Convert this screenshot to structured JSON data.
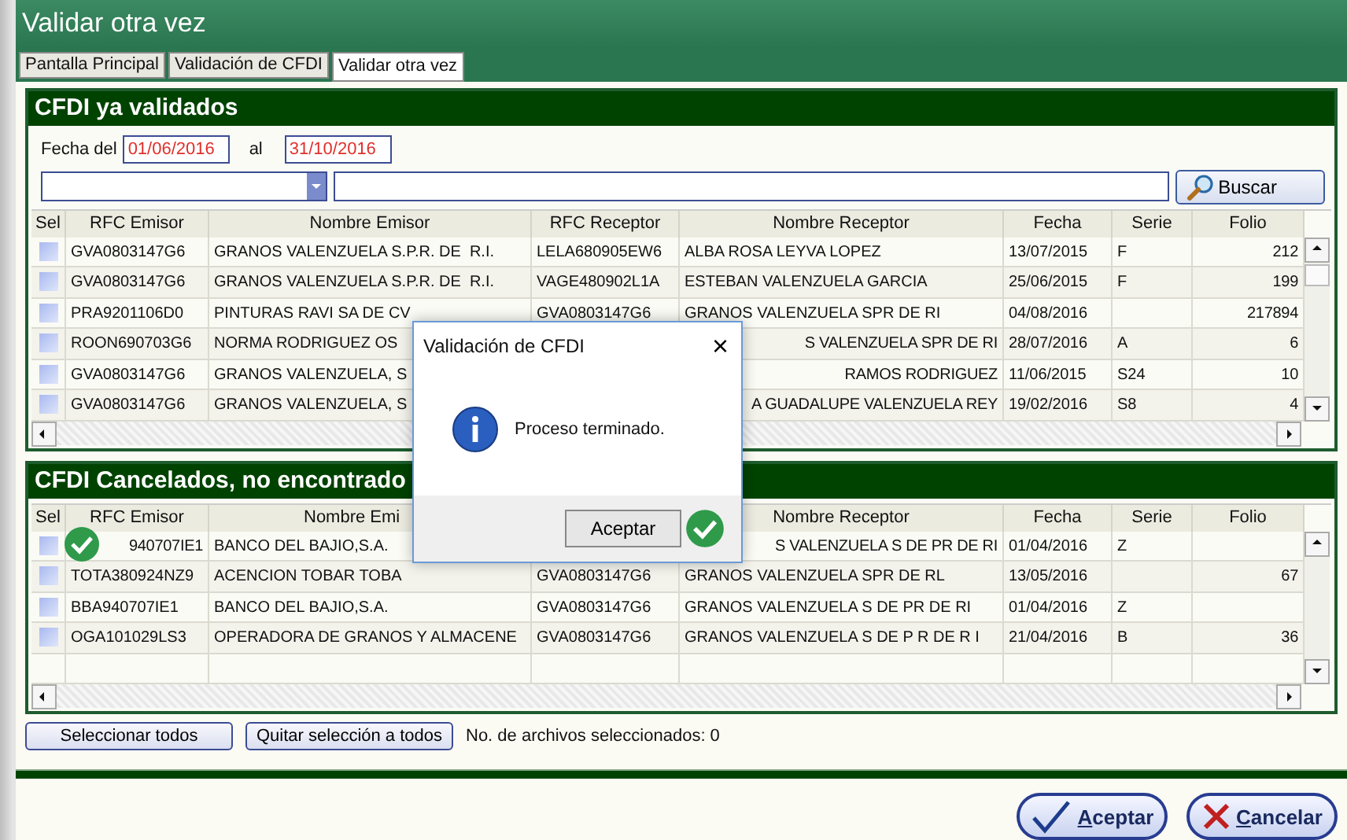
{
  "window": {
    "title": "Validar otra vez"
  },
  "tabs": [
    {
      "label": "Pantalla Principal",
      "selected": false
    },
    {
      "label": "Validación de CFDI",
      "selected": false
    },
    {
      "label": "Validar otra vez",
      "selected": true
    }
  ],
  "validated": {
    "title": "CFDI ya validados",
    "date_from_label": "Fecha del",
    "date_from": "01/06/2016",
    "date_to_label": "al",
    "date_to": "31/10/2016",
    "search_button": "Buscar",
    "selection_column": "Sel",
    "columns": [
      "RFC Emisor",
      "Nombre Emisor",
      "RFC Receptor",
      "Nombre Receptor",
      "Fecha",
      "Serie",
      "Folio"
    ],
    "rows": [
      {
        "checked": false,
        "cells": [
          "GVA0803147G6",
          "GRANOS VALENZUELA S.P.R. DE  R.I.",
          "LELA680905EW6",
          "ALBA ROSA LEYVA LOPEZ",
          "13/07/2015",
          "F",
          "212"
        ]
      },
      {
        "checked": false,
        "cells": [
          "GVA0803147G6",
          "GRANOS VALENZUELA S.P.R. DE  R.I.",
          "VAGE480902L1A",
          "ESTEBAN VALENZUELA GARCIA",
          "25/06/2015",
          "F",
          "199"
        ]
      },
      {
        "checked": false,
        "cells": [
          "PRA9201106D0",
          "PINTURAS RAVI SA DE CV",
          "GVA0803147G6",
          "GRANOS VALENZUELA SPR DE RI",
          "04/08/2016",
          null,
          "217894"
        ]
      },
      {
        "checked": false,
        "cells": [
          "ROON690703G6",
          "NORMA RODRIGUEZ OS",
          null,
          {
            "text": "S VALENZUELA SPR DE RI",
            "clipped": true
          },
          "28/07/2016",
          "A",
          "6"
        ]
      },
      {
        "checked": false,
        "cells": [
          "GVA0803147G6",
          "GRANOS VALENZUELA, S",
          null,
          {
            "text": "RAMOS RODRIGUEZ",
            "clipped": true
          },
          "11/06/2015",
          "S24",
          "10"
        ]
      },
      {
        "checked": false,
        "cells": [
          "GVA0803147G6",
          "GRANOS VALENZUELA, S",
          null,
          {
            "text": "A GUADALUPE VALENZUELA REY",
            "clipped": true
          },
          "19/02/2016",
          "S8",
          "4"
        ]
      }
    ]
  },
  "cancelled": {
    "title": "CFDI Cancelados, no encontrado",
    "selection_column": "Sel",
    "columns": [
      "RFC Emisor",
      {
        "text": "Nombre Emi",
        "clipped": true
      },
      null,
      "Nombre Receptor",
      "Fecha",
      "Serie",
      "Folio"
    ],
    "rows": [
      {
        "checked": false,
        "cells": [
          {
            "text": "940707IE1",
            "clipped": true
          },
          "BANCO DEL BAJIO,S.A.",
          null,
          {
            "text": "S VALENZUELA S DE PR DE RI",
            "clipped": true
          },
          "01/04/2016",
          "Z",
          null
        ]
      },
      {
        "checked": false,
        "cells": [
          "TOTA380924NZ9",
          "ACENCION TOBAR TOBA",
          "GVA0803147G6",
          "GRANOS VALENZUELA SPR DE RL",
          "13/05/2016",
          null,
          "67"
        ]
      },
      {
        "checked": false,
        "cells": [
          "BBA940707IE1",
          "BANCO DEL BAJIO,S.A.",
          "GVA0803147G6",
          "GRANOS VALENZUELA S DE PR DE RI",
          "01/04/2016",
          "Z",
          null
        ]
      },
      {
        "checked": false,
        "cells": [
          "OGA101029LS3",
          "OPERADORA DE GRANOS Y ALMACENE",
          "GVA0803147G6",
          "GRANOS VALENZUELA S DE P R DE R I",
          "21/04/2016",
          "B",
          "36"
        ]
      }
    ]
  },
  "select_all_button": "Seleccionar todos",
  "clear_selection_button": "Quitar selección a todos",
  "selected_count": "No. de archivos seleccionados: 0",
  "footer_buttons": [
    {
      "label": "Aceptar",
      "kind": "accept"
    },
    {
      "label": "Cancelar",
      "kind": "cancel"
    }
  ],
  "dialog": {
    "title": "Validación de CFDI",
    "close": "×",
    "message": "Proceso terminado.",
    "button": "Aceptar"
  }
}
